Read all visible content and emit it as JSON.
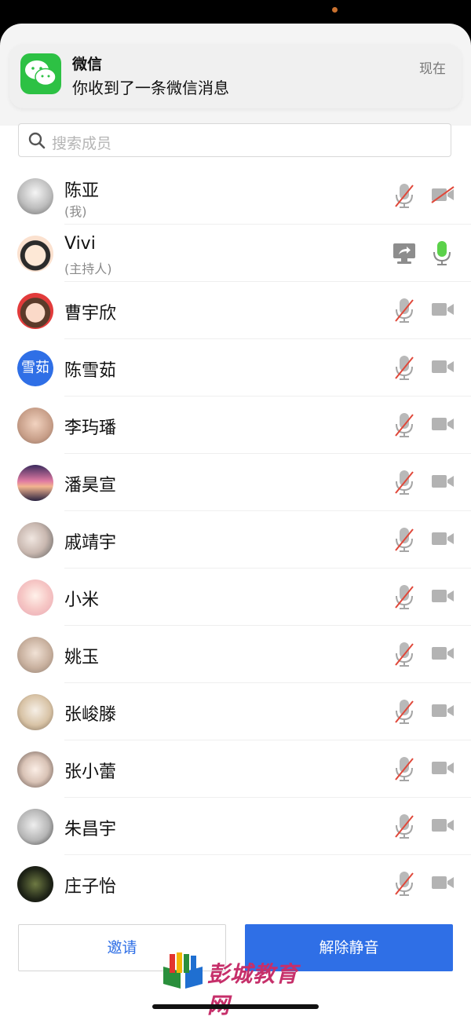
{
  "notification": {
    "app_name": "微信",
    "message": "你收到了一条微信消息",
    "time": "现在"
  },
  "search": {
    "placeholder": "搜索成员"
  },
  "members": [
    {
      "name": "陈亚",
      "sub": "(我)",
      "avatar": "photo",
      "mic": "muted",
      "camera": "off"
    },
    {
      "name": "Vivi",
      "sub": "(主持人)",
      "avatar": "cartoon",
      "mic": "active",
      "camera": "screen-share"
    },
    {
      "name": "曹宇欣",
      "avatar": "cartoon-girl",
      "mic": "muted",
      "camera": "on"
    },
    {
      "name": "陈雪茹",
      "avatar_text": "雪茹",
      "mic": "muted",
      "camera": "on"
    },
    {
      "name": "李玙璠",
      "avatar": "photo",
      "mic": "muted",
      "camera": "on"
    },
    {
      "name": "潘昊宣",
      "avatar": "photo",
      "mic": "muted",
      "camera": "on"
    },
    {
      "name": "戚靖宇",
      "avatar": "photo",
      "mic": "muted",
      "camera": "on"
    },
    {
      "name": "小米",
      "avatar": "anime",
      "mic": "muted",
      "camera": "on"
    },
    {
      "name": "姚玉",
      "avatar": "photo",
      "mic": "muted",
      "camera": "on"
    },
    {
      "name": "张峻滕",
      "avatar": "photo",
      "mic": "muted",
      "camera": "on"
    },
    {
      "name": "张小蕾",
      "avatar": "cartoon",
      "mic": "muted",
      "camera": "on"
    },
    {
      "name": "朱昌宇",
      "avatar": "photo",
      "mic": "muted",
      "camera": "on"
    },
    {
      "name": "庄子怡",
      "avatar": "photo",
      "mic": "muted",
      "camera": "on"
    }
  ],
  "buttons": {
    "invite": "邀请",
    "unmute": "解除静音"
  },
  "watermark": {
    "text": "彭城教育网"
  },
  "colors": {
    "accent": "#2f6fe6",
    "wechat": "#2dc144",
    "mic_active": "#5bd14a",
    "mute_slash": "#e0483a"
  }
}
